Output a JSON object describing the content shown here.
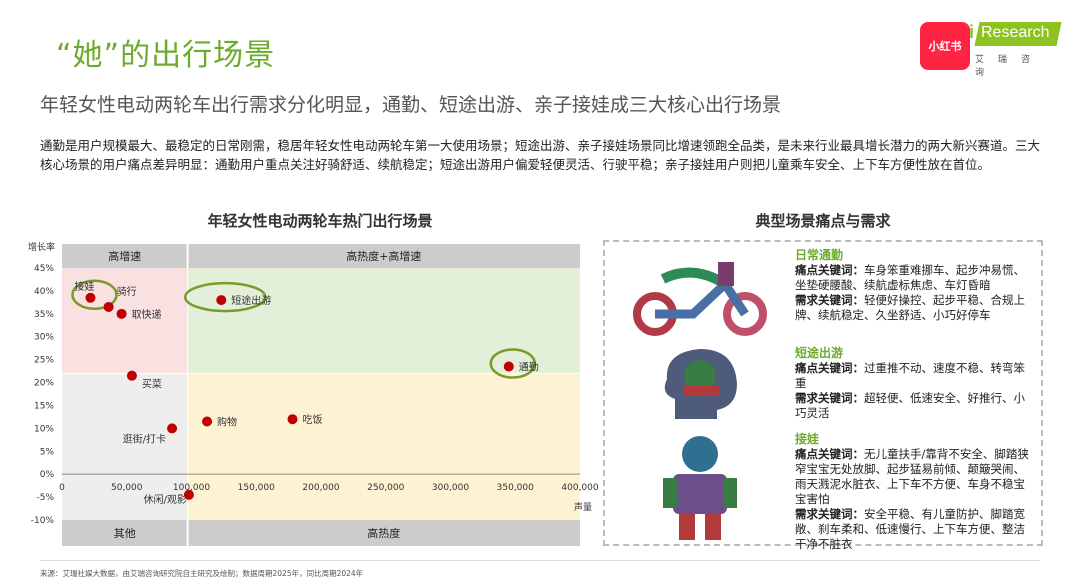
{
  "header": {
    "title": "“她”的出行场景",
    "subtitle": "年轻女性电动两轮车出行需求分化明显，通勤、短途出游、亲子接娃成三大核心出行场景",
    "logo_xhs": "小红书",
    "logo_ir": "Research",
    "logo_ir_i": "i",
    "logo_ir_cn": "艾瑞咨询"
  },
  "intro": "通勤是用户规模最大、最稳定的日常刚需，稳居年轻女性电动两轮车第一大使用场景；短途出游、亲子接娃场景同比增速领跑全品类，是未来行业最具增长潜力的两大新兴赛道。三大核心场景的用户痛点差异明显：通勤用户重点关注好骑舒适、续航稳定；短途出游用户偏爱轻便灵活、行驶平稳；亲子接娃用户则把儿童乘车安全、上下车方便性放在首位。",
  "chart_data": {
    "type": "scatter",
    "title": "年轻女性电动两轮车热门出行场景",
    "xlabel": "声量",
    "ylabel": "增长率",
    "xlim": [
      0,
      400000
    ],
    "ylim": [
      -10,
      45
    ],
    "x_ticks": [
      "0",
      "50,000",
      "100,000",
      "150,000",
      "200,000",
      "250,000",
      "300,000",
      "350,000",
      "400,000"
    ],
    "y_ticks": [
      "45%",
      "40%",
      "35%",
      "30%",
      "25%",
      "20%",
      "15%",
      "10%",
      "5%",
      "0%",
      "-5%",
      "-10%"
    ],
    "quadrants": {
      "top_left": "高增速",
      "top_right": "高热度+高增速",
      "bottom_left": "其他",
      "bottom_right": "高热度"
    },
    "divider": {
      "x": 97000,
      "y": 22
    },
    "points": [
      {
        "label": "接娃",
        "x": 22000,
        "y": 38.5,
        "highlight": true
      },
      {
        "label": "骑行",
        "x": 36000,
        "y": 36.5,
        "highlight": false
      },
      {
        "label": "取快递",
        "x": 46000,
        "y": 35,
        "highlight": false
      },
      {
        "label": "短途出游",
        "x": 123000,
        "y": 38,
        "highlight": true
      },
      {
        "label": "通勤",
        "x": 345000,
        "y": 23.5,
        "highlight": true
      },
      {
        "label": "买菜",
        "x": 54000,
        "y": 21.5,
        "highlight": false
      },
      {
        "label": "购物",
        "x": 112000,
        "y": 11.5,
        "highlight": false
      },
      {
        "label": "吃饭",
        "x": 178000,
        "y": 12,
        "highlight": false
      },
      {
        "label": "逛街/打卡",
        "x": 85000,
        "y": 10,
        "highlight": false
      },
      {
        "label": "休闲/观影",
        "x": 98000,
        "y": -4.5,
        "highlight": false
      }
    ],
    "colors": {
      "point": "#c00000",
      "highlight_ring": "#7a9a2a",
      "quad_tl": "#f9e1e1",
      "quad_tr": "#e3efd8",
      "quad_bl": "#eeeeee",
      "quad_br": "#fdf3d2",
      "header_band": "#cccccc"
    }
  },
  "panel": {
    "title": "典型场景痛点与需求",
    "scenes": [
      {
        "name": "日常通勤",
        "pain_label": "痛点关键词：",
        "pain": "车身笨重难挪车、起步冲易慌、坐垫硬腰酸、续航虚标焦虑、车灯昏暗",
        "need_label": "需求关键词：",
        "need": "轻便好操控、起步平稳、合规上牌、续航稳定、久坐舒适、小巧好停车"
      },
      {
        "name": "短途出游",
        "pain_label": "痛点关键词：",
        "pain": "过重推不动、速度不稳、转弯笨重",
        "need_label": "需求关键词：",
        "need": "超轻便、低速安全、好推行、小巧灵活"
      },
      {
        "name": "接娃",
        "pain_label": "痛点关键词：",
        "pain": "无儿童扶手/靠背不安全、脚踏狭窄宝宝无处放脚、起步猛易前倾、颠簸哭闹、雨天溅泥水脏衣、上下车不方便、车身不稳宝宝害怕",
        "need_label": "需求关键词：",
        "need": "安全平稳、有儿童防护、脚踏宽敞、刹车柔和、低速慢行、上下车方便、整洁干净不脏衣"
      }
    ]
  },
  "source": "来源：艾瑞社媒大数据，由艾瑞咨询研究院自主研究及绘制；数据周期2025年，同比周期2024年"
}
